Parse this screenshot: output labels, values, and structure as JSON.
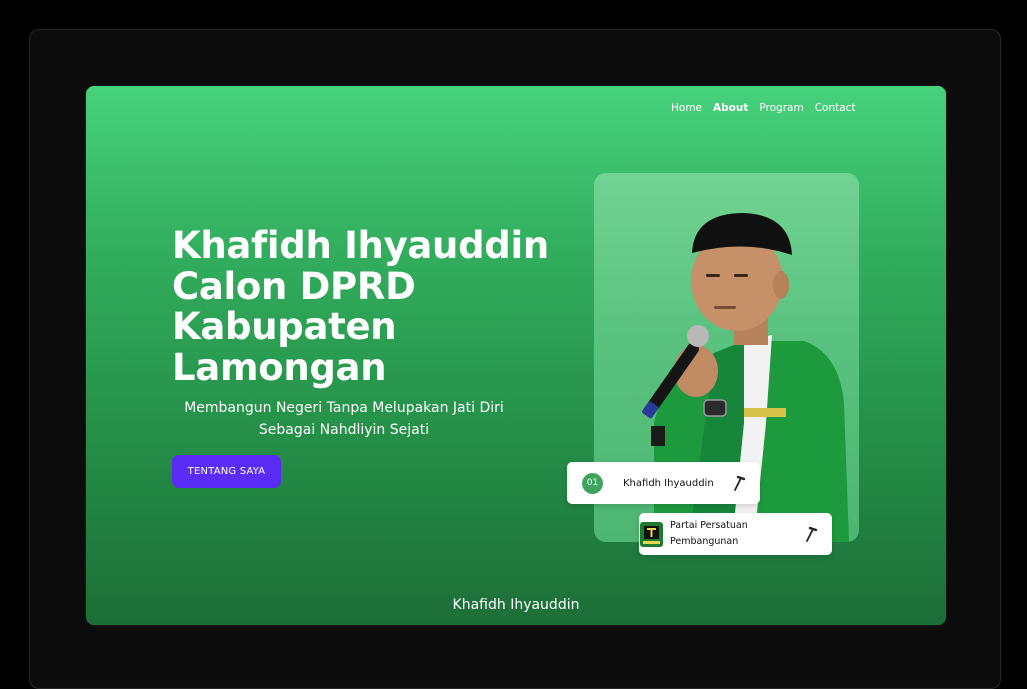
{
  "nav": {
    "items": [
      "Home",
      "About",
      "Program",
      "Contact"
    ],
    "active": "About"
  },
  "hero": {
    "title_lines": [
      "Khafidh Ihyauddin",
      "Calon DPRD",
      "Kabupaten",
      "Lamongan"
    ],
    "subtitle_lines": [
      "Membangun Negeri Tanpa Melupakan Jati Diri",
      "Sebagai Nahdliyin Sejati"
    ],
    "cta_label": "TENTANG SAYA"
  },
  "cards": {
    "name_number": "01",
    "name": "Khafidh Ihyauddin",
    "party_line1": "Partai Persatuan",
    "party_line2": "Pembangunan",
    "tool_icon": "hammer-icon",
    "party_logo_text": "PPP"
  },
  "footer": {
    "name": "Khafidh Ihyauddin"
  },
  "colors": {
    "accent_button": "#5b2cf6",
    "hero_green_top": "#47d27d",
    "hero_green_bottom": "#1c6e37",
    "badge_green": "#3fa45f"
  }
}
